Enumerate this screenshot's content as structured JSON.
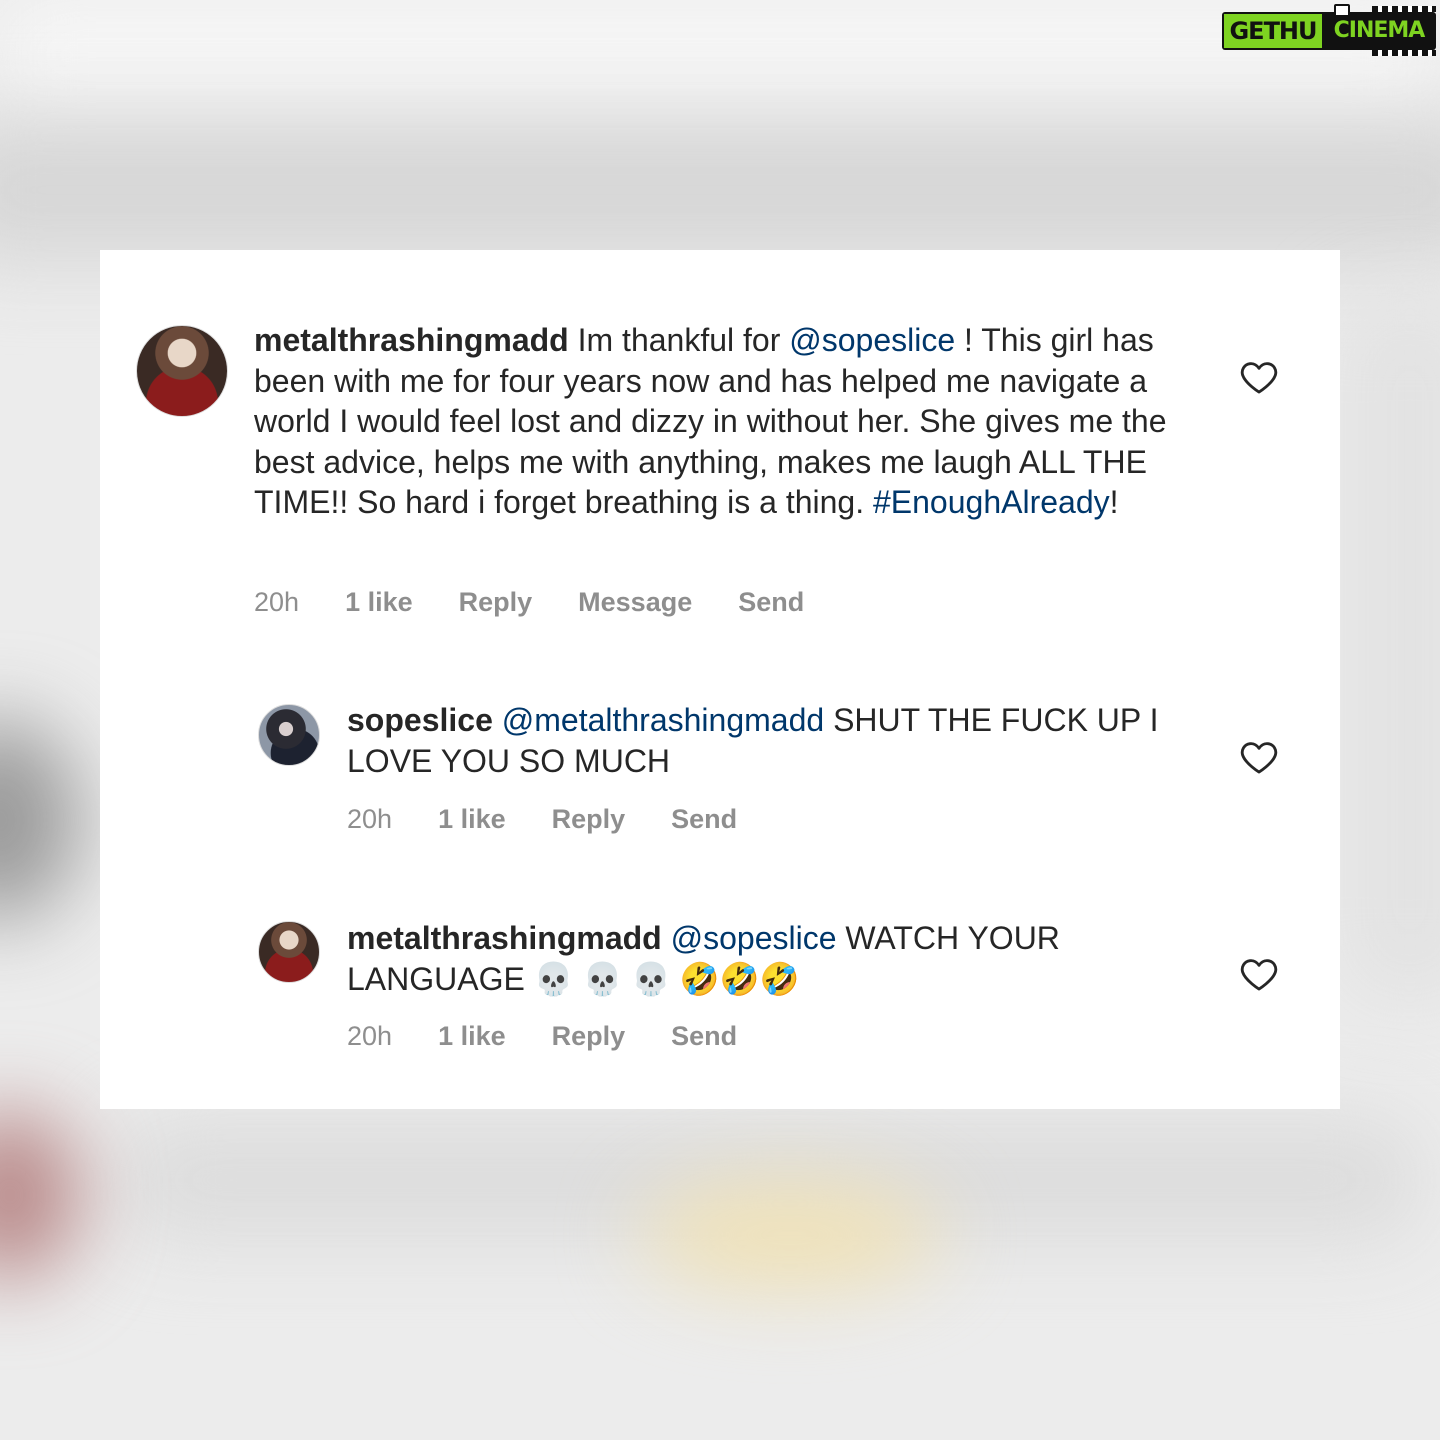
{
  "watermark": {
    "left": "GETHU",
    "right": "CINEMA"
  },
  "comments": [
    {
      "username": "metalthrashingmadd",
      "parts": [
        {
          "t": " Im thankful for ",
          "m": false
        },
        {
          "t": "@sopeslice",
          "m": true
        },
        {
          "t": " ! This girl has been with me for four years now and has helped me navigate a world I would feel lost and dizzy in without her. She gives me the best advice, helps me with anything, makes me laugh ALL THE TIME!! So hard i forget breathing is a thing. ",
          "m": false
        },
        {
          "t": "#EnoughAlready",
          "m": true
        },
        {
          "t": "!",
          "m": false
        }
      ],
      "time": "20h",
      "likes": "1 like",
      "actions": [
        "Reply",
        "Message",
        "Send"
      ]
    },
    {
      "username": "sopeslice",
      "parts": [
        {
          "t": " ",
          "m": false
        },
        {
          "t": "@metalthrashingmadd",
          "m": true
        },
        {
          "t": " SHUT THE FUCK UP I LOVE YOU SO MUCH",
          "m": false
        }
      ],
      "time": "20h",
      "likes": "1 like",
      "actions": [
        "Reply",
        "Send"
      ]
    },
    {
      "username": "metalthrashingmadd",
      "parts": [
        {
          "t": " ",
          "m": false
        },
        {
          "t": "@sopeslice",
          "m": true
        },
        {
          "t": " WATCH YOUR LANGUAGE 💀 💀 💀 🤣🤣🤣",
          "m": false
        }
      ],
      "time": "20h",
      "likes": "1 like",
      "actions": [
        "Reply",
        "Send"
      ]
    }
  ],
  "icons": {
    "like": "heart-outline-icon",
    "avatar": "profile-avatar"
  },
  "colors": {
    "mention": "#00376b",
    "text": "#262626",
    "meta": "#8e8e8e"
  }
}
